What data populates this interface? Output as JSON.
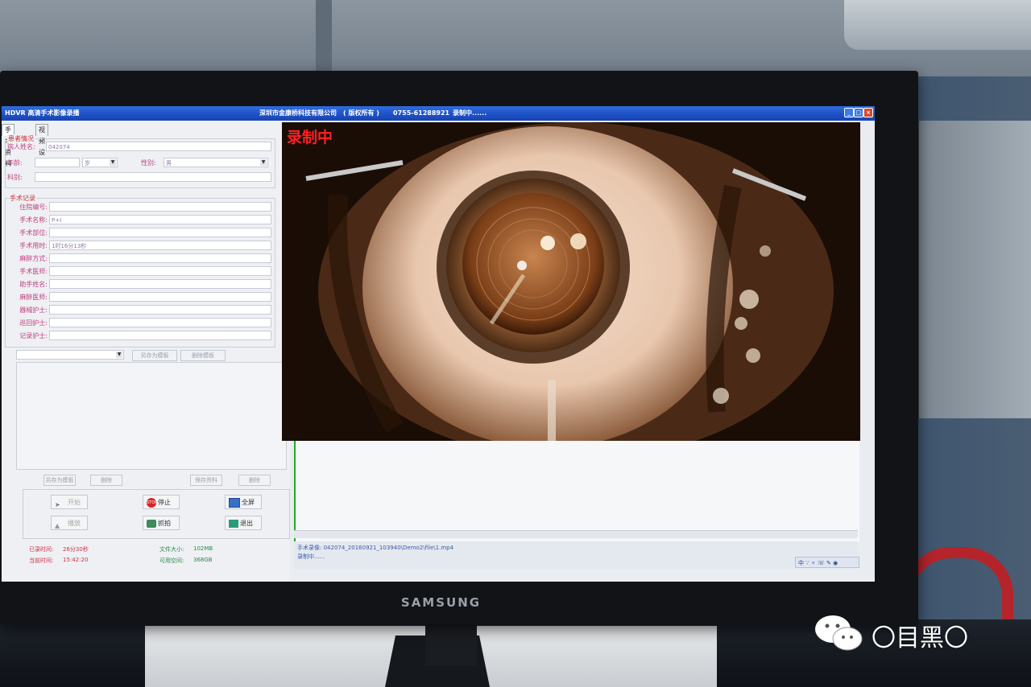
{
  "window": {
    "title": "HDVR 高清手术影像录播",
    "company": "深圳市金康桥科技有限公司",
    "rights": "( 版权所有 )",
    "phone": "0755-61288921",
    "state": "录制中......"
  },
  "tabs": [
    "手术资料",
    "视频设置"
  ],
  "patient": {
    "section_title": "患者情况",
    "name_label": "病人姓名:",
    "name_value": "042074",
    "age_label": "年龄:",
    "age_unit": "岁",
    "gender_label": "性别:",
    "gender_value": "男",
    "cost_label": "科别:"
  },
  "surgery": {
    "section_title": "手术记录",
    "fields": [
      {
        "label": "住院编号:",
        "value": ""
      },
      {
        "label": "手术名称:",
        "value": "P+I"
      },
      {
        "label": "手术部位:",
        "value": ""
      },
      {
        "label": "手术用时:",
        "value": "1时16分13秒"
      },
      {
        "label": "麻醉方式:",
        "value": ""
      },
      {
        "label": "手术医师:",
        "value": ""
      },
      {
        "label": "助手姓名:",
        "value": ""
      },
      {
        "label": "麻醉医师:",
        "value": ""
      },
      {
        "label": "器械护士:",
        "value": ""
      },
      {
        "label": "巡回护士:",
        "value": ""
      },
      {
        "label": "记录护士:",
        "value": ""
      }
    ]
  },
  "mid_buttons": [
    "另存为模板",
    "删除模板",
    "另存为模板",
    "删除",
    "另存为模板",
    "保存资料",
    "删除"
  ],
  "controls": {
    "stop": "停止",
    "full": "全屏",
    "capture": "抓拍",
    "exit": "退出",
    "start": "开始",
    "play": "播放"
  },
  "status": {
    "rec_time_label": "已录时间:",
    "rec_time_value": "26分30秒",
    "now_label": "当前时间:",
    "now_value": "15:42:20",
    "file_size_label": "文件大小:",
    "file_size_value": "102MB",
    "free_label": "可用空间:",
    "free_value": "368GB"
  },
  "video_overlay": "录制中",
  "info": {
    "path": "手术录像: 042074_20160921_103940\\Demo2\\file\\1.mp4",
    "line2": "录制中......"
  },
  "tray": "中 ∵ ⚬ ☏ ✎ ◉",
  "monitor_brand": "SAMSUNG",
  "watermark": "〇目黑〇"
}
